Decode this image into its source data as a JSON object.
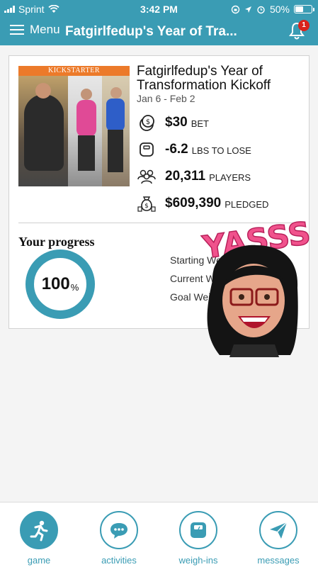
{
  "status_bar": {
    "carrier": "Sprint",
    "time": "3:42 PM",
    "battery": "50%"
  },
  "nav": {
    "menu_label": "Menu",
    "title": "Fatgirlfedup's Year of Tra...",
    "notification_count": "1"
  },
  "game": {
    "image_tag": "KICKSTARTER",
    "title": "Fatgirlfedup's Year of Transformation Kickoff",
    "dates": "Jan 6 - Feb 2",
    "stats": {
      "bet_value": "$30",
      "bet_unit": "BET",
      "lose_value": "-6.2",
      "lose_unit": "LBS TO LOSE",
      "players_value": "20,311",
      "players_unit": "PLAYERS",
      "pledged_value": "$609,390",
      "pledged_unit": "PLEDGED"
    }
  },
  "progress": {
    "title": "Your progress",
    "percent": "100",
    "percent_symbol": "%",
    "starting_label": "Starting Weight",
    "current_label": "Current Weight",
    "goal_label": "Goal Weight"
  },
  "sticker": {
    "text": "YASSS"
  },
  "tabs": [
    {
      "label": "game",
      "icon": "runner-icon",
      "active": true
    },
    {
      "label": "activities",
      "icon": "chat-bubble-icon",
      "active": false
    },
    {
      "label": "weigh-ins",
      "icon": "scale-icon",
      "active": false
    },
    {
      "label": "messages",
      "icon": "paper-plane-icon",
      "active": false
    }
  ],
  "colors": {
    "brand": "#3a9cb4",
    "badge": "#d9241c",
    "sticker_pink": "#f0528c"
  }
}
